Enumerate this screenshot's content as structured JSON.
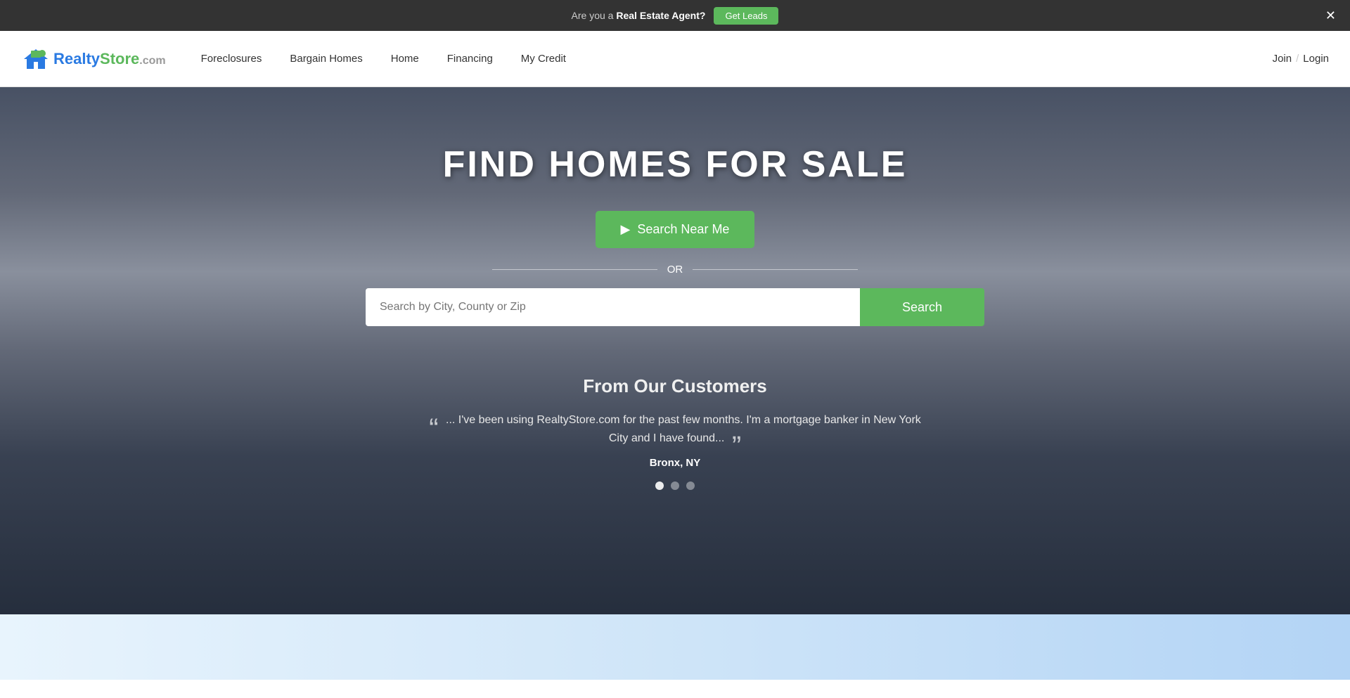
{
  "top_banner": {
    "text_prefix": "Are you a ",
    "text_bold": "Real Estate Agent?",
    "get_leads_label": "Get Leads",
    "close_symbol": "✕"
  },
  "header": {
    "logo_realty": "Realty",
    "logo_store": "Store",
    "logo_com": ".com",
    "nav": [
      {
        "label": "Foreclosures",
        "id": "foreclosures"
      },
      {
        "label": "Bargain Homes",
        "id": "bargain-homes"
      },
      {
        "label": "Home",
        "id": "home"
      },
      {
        "label": "Financing",
        "id": "financing"
      },
      {
        "label": "My Credit",
        "id": "my-credit"
      }
    ],
    "join_label": "Join",
    "divider": "/",
    "login_label": "Login"
  },
  "hero": {
    "title": "FIND HOMES FOR SALE",
    "search_near_me_label": "Search Near Me",
    "or_label": "OR",
    "search_input_placeholder": "Search by City, County or Zip",
    "search_button_label": "Search"
  },
  "testimonials": {
    "section_title": "From Our Customers",
    "quote_text": "... I've been using RealtyStore.com for the past few months. I'm a mortgage banker in New York City and I have found...",
    "location": "Bronx, NY",
    "dots": [
      {
        "active": true
      },
      {
        "active": false
      },
      {
        "active": false
      }
    ]
  }
}
